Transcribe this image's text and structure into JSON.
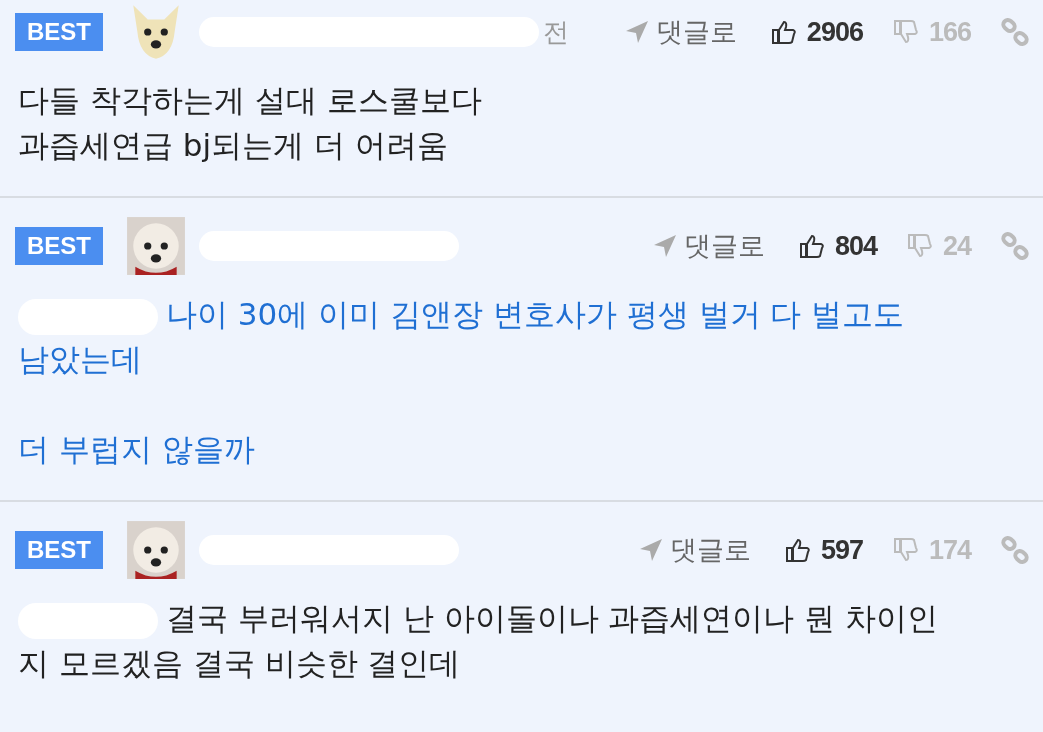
{
  "comments": [
    {
      "badge": "BEST",
      "time": "전",
      "reply": "댓글로",
      "likes": "2906",
      "dislikes": "166",
      "highlighted": false,
      "redacted_prefix": false,
      "paragraphs": [
        [
          "다들 착각하는게 설대 로스쿨보다",
          "과즙세연급 bj되는게 더 어려움"
        ]
      ]
    },
    {
      "badge": "BEST",
      "reply": "댓글로",
      "likes": "804",
      "dislikes": "24",
      "highlighted": true,
      "redacted_prefix": true,
      "paragraphs": [
        [
          "나이 30에 이미 김앤장 변호사가 평생 벌거 다 벌고도",
          "남았는데"
        ],
        [
          "더 부럽지 않을까"
        ]
      ]
    },
    {
      "badge": "BEST",
      "reply": "댓글로",
      "likes": "597",
      "dislikes": "174",
      "highlighted": false,
      "redacted_prefix": true,
      "paragraphs": [
        [
          "결국 부러워서지 난 아이돌이나 과즙세연이나 뭔 차이인",
          "지 모르겠음 결국 비슷한 결인데"
        ]
      ]
    }
  ]
}
